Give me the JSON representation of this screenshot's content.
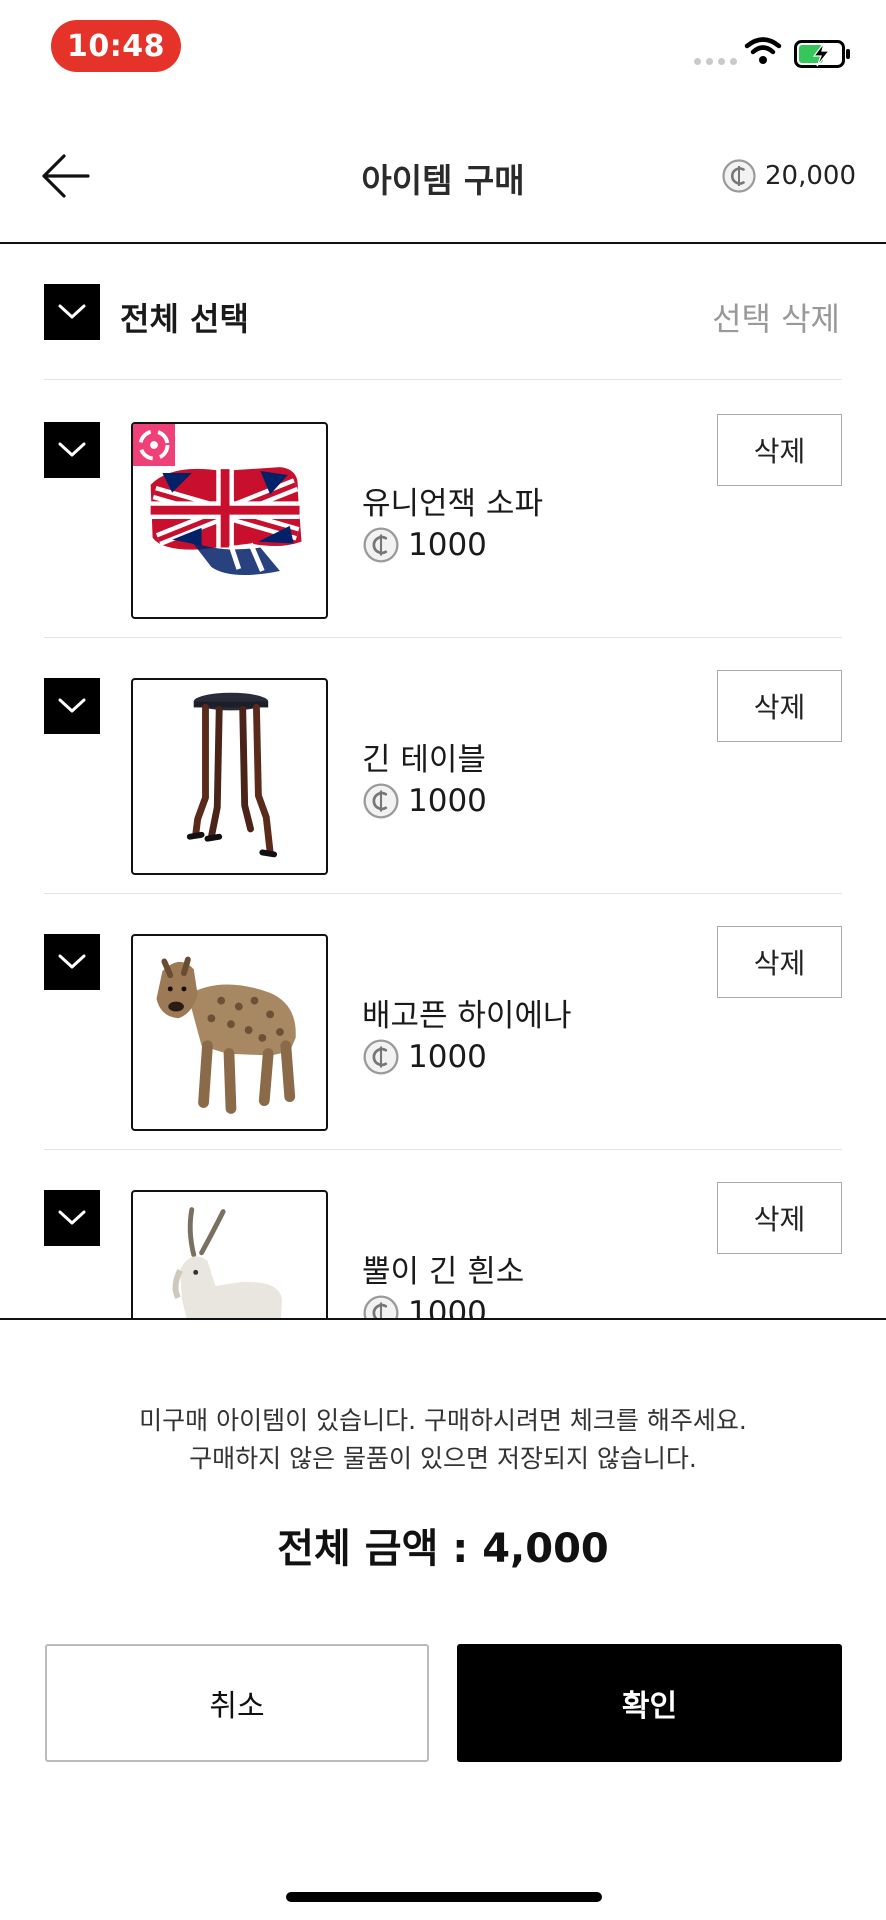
{
  "status_bar": {
    "time": "10:48"
  },
  "header": {
    "title": "아이템 구매",
    "balance": "20,000"
  },
  "list": {
    "select_all_label": "전체 선택",
    "delete_selected_label": "선택 삭제",
    "items": [
      {
        "name": "유니언잭 소파",
        "price": "1000",
        "delete_label": "삭제",
        "icon": "union-jack-sofa"
      },
      {
        "name": "긴 테이블",
        "price": "1000",
        "delete_label": "삭제",
        "icon": "tall-table"
      },
      {
        "name": "배고픈 하이에나",
        "price": "1000",
        "delete_label": "삭제",
        "icon": "hyena"
      },
      {
        "name": "뿔이 긴 흰소",
        "price": "1000",
        "delete_label": "삭제",
        "icon": "long-horned-antelope"
      }
    ]
  },
  "footer": {
    "notice_line1": "미구매 아이템이 있습니다. 구매하시려면 체크를 해주세요.",
    "notice_line2": "구매하지 않은 물품이 있으면 저장되지 않습니다.",
    "total_label": "전체 금액 : 4,000",
    "cancel_label": "취소",
    "confirm_label": "확인"
  },
  "colors": {
    "accent": "#000000",
    "time_pill": "#e5332a",
    "ar_badge": "#f0407a",
    "muted_text": "#999999"
  }
}
